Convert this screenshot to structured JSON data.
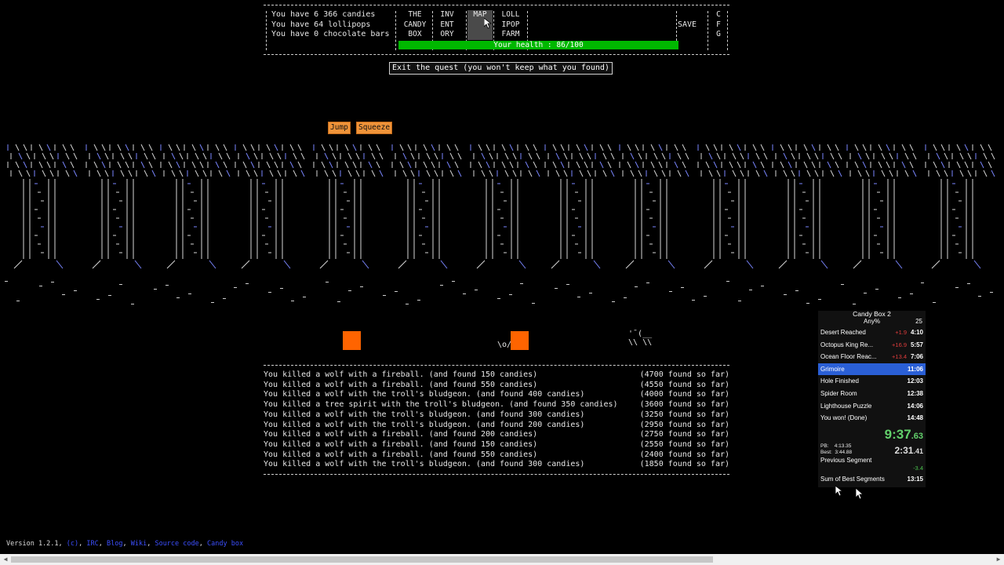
{
  "status": {
    "candies": "You have 6 366 candies",
    "lollipops": "You have 64 lollipops",
    "chocolate": "You have 0 chocolate bars"
  },
  "tabs": [
    {
      "l1": "THE",
      "l2": "CANDY",
      "l3": "BOX"
    },
    {
      "l1": "INV",
      "l2": "ENT",
      "l3": "ORY"
    },
    {
      "l1": "",
      "l2": "MAP",
      "l3": ""
    },
    {
      "l1": "LOLL",
      "l2": "IPOP",
      "l3": "FARM"
    }
  ],
  "save_label": "SAVE",
  "config_tab": {
    "l1": "C",
    "l2": "F",
    "l3": "G"
  },
  "health": {
    "text": "Your health : 86/100",
    "current": 86,
    "max": 100
  },
  "exit_button": "Exit the quest (you won't keep what you found)",
  "spells": {
    "jump": "Jump",
    "squeeze": "Squeeze"
  },
  "player_sprite": "\\o/",
  "enemy_sprite": " '¯(__\n \\\\ \\\\",
  "log": [
    {
      "msg": "You killed a wolf with a fireball. (and found 150 candies)",
      "total": "(4700 found so far)"
    },
    {
      "msg": "You killed a wolf with a fireball. (and found 550 candies)",
      "total": "(4550 found so far)"
    },
    {
      "msg": "You killed a wolf with the troll's bludgeon. (and found 400 candies)",
      "total": "(4000 found so far)"
    },
    {
      "msg": "You killed a tree spirit with the troll's bludgeon. (and found 350 candies)",
      "total": "(3600 found so far)"
    },
    {
      "msg": "You killed a wolf with the troll's bludgeon. (and found 300 candies)",
      "total": "(3250 found so far)"
    },
    {
      "msg": "You killed a wolf with the troll's bludgeon. (and found 200 candies)",
      "total": "(2950 found so far)"
    },
    {
      "msg": "You killed a wolf with a fireball. (and found 200 candies)",
      "total": "(2750 found so far)"
    },
    {
      "msg": "You killed a wolf with a fireball. (and found 150 candies)",
      "total": "(2550 found so far)"
    },
    {
      "msg": "You killed a wolf with a fireball. (and found 550 candies)",
      "total": "(2400 found so far)"
    },
    {
      "msg": "You killed a wolf with the troll's bludgeon. (and found 300 candies)",
      "total": "(1850 found so far)"
    }
  ],
  "timer": {
    "title": "Candy Box 2",
    "category": "Any%",
    "attempts": "25",
    "splits": [
      {
        "name": "Desert Reached",
        "delta": "+1.9",
        "time": "4:10"
      },
      {
        "name": "Octopus King Re...",
        "delta": "+16.9",
        "time": "5:57"
      },
      {
        "name": "Ocean Floor Reac...",
        "delta": "+13.4",
        "time": "7:06"
      },
      {
        "name": "Grimoire",
        "delta": "",
        "time": "11:06"
      },
      {
        "name": "Hole Finished",
        "delta": "",
        "time": "12:03"
      },
      {
        "name": "Spider Room",
        "delta": "",
        "time": "12:38"
      },
      {
        "name": "Lighthouse Puzzle",
        "delta": "",
        "time": "14:06"
      },
      {
        "name": "You won! (Done)",
        "delta": "",
        "time": "14:48"
      }
    ],
    "main_time": "9:37",
    "main_ms": ".63",
    "segment_time": "2:31",
    "segment_ms": ".41",
    "pb": "PB:    4:13.35",
    "best": "Best:  3:44.88",
    "previous_segment_label": "Previous Segment",
    "previous_segment_value": "-3.4",
    "sum_of_best_label": "Sum of Best Segments",
    "sum_of_best_value": "13:15",
    "colors": {
      "ahead": "#62d06b",
      "behind": "#e03c3c",
      "current": "#2a5fd6"
    }
  },
  "footer": {
    "version": "Version 1.2.1, ",
    "links": [
      "(c)",
      "IRC",
      "Blog",
      "Wiki",
      "Source code",
      "Candy box"
    ]
  },
  "colors": {
    "health_bar": "#00b800",
    "square": "#ff6400",
    "spell_button": "#f0943a",
    "link": "#3c4fff"
  }
}
